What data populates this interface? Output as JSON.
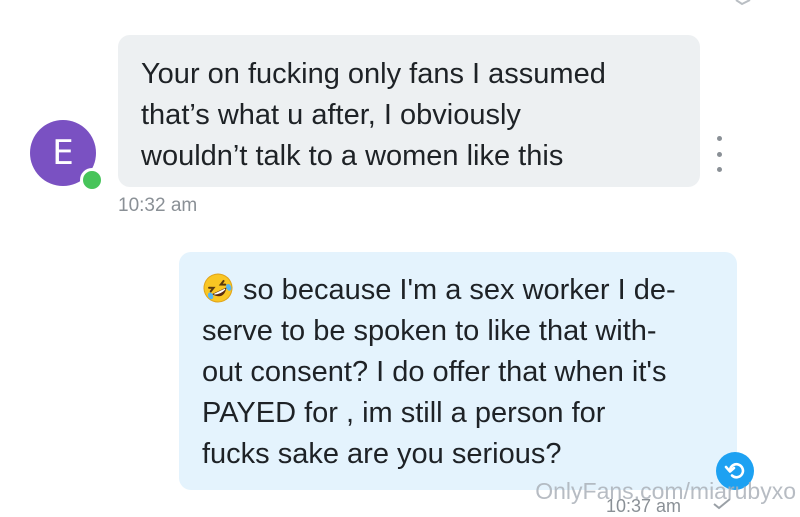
{
  "incoming": {
    "avatar_letter": "E",
    "lines": [
      "Your on fucking only fans I assumed",
      "that’s what u after, I obviously",
      "wouldn’t talk to a women like this"
    ],
    "time": "10:32 am"
  },
  "outgoing": {
    "emoji": "rolling-on-floor-laughing-emoji",
    "lines": [
      "so because I'm a sex worker I de-",
      "serve to be spoken to like that with-",
      "out consent? I do offer that when it's",
      "PAYED for , im still a person for",
      "fucks sake are you serious?"
    ],
    "time": "10:37 am"
  },
  "watermark": "OnlyFans.com/miarubyxo",
  "icons": {
    "more": "vertical-ellipsis-icon",
    "undo": "undo-icon",
    "sent": "check-icon",
    "online": "online-status-dot"
  },
  "colors": {
    "avatar": "#7a51c2",
    "online": "#47c45a",
    "incoming_bubble": "#edf0f2",
    "outgoing_bubble": "#e4f3fd",
    "accent": "#1da1f2"
  }
}
